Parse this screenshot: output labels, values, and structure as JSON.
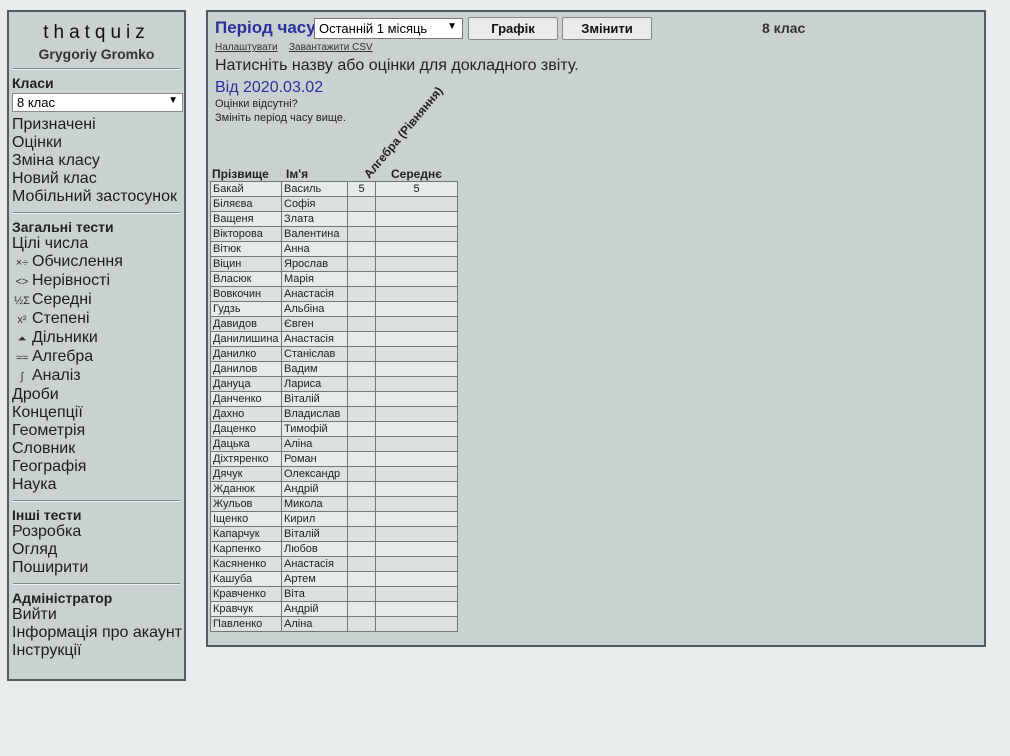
{
  "sidebar": {
    "logo": "thatquiz",
    "user": "Grygoriy Gromko",
    "classes_title": "Класи",
    "class_select": "8 клас",
    "class_items": [
      "Призначені",
      "Оцінки",
      "Зміна класу",
      "Новий клас",
      "Мобільний застосунок"
    ],
    "general_title": "Загальні тести",
    "general_items": [
      {
        "label": "Цілі числа",
        "icon": ""
      },
      {
        "label": "Обчислення",
        "icon": "calc-icon"
      },
      {
        "label": "Нерівності",
        "icon": "inequality-icon"
      },
      {
        "label": "Середні",
        "icon": "sigma-icon"
      },
      {
        "label": "Степені",
        "icon": "power-icon"
      },
      {
        "label": "Дільники",
        "icon": "tree-icon"
      },
      {
        "label": "Алгебра",
        "icon": "algebra-icon"
      },
      {
        "label": "Аналіз",
        "icon": "integral-icon"
      },
      {
        "label": "Дроби",
        "icon": ""
      },
      {
        "label": "Концепції",
        "icon": ""
      },
      {
        "label": "Геометрія",
        "icon": ""
      },
      {
        "label": "Словник",
        "icon": ""
      },
      {
        "label": "Географія",
        "icon": ""
      },
      {
        "label": "Наука",
        "icon": ""
      }
    ],
    "other_title": "Інші тести",
    "other_items": [
      "Розробка",
      "Огляд",
      "Поширити"
    ],
    "admin_title": "Адміністратор",
    "admin_items": [
      "Вийти",
      "Інформація про акаунт",
      "Інструкції"
    ]
  },
  "main": {
    "period_title": "Період часу",
    "period_select": "Останній 1 місяць",
    "graph_button": "Графік",
    "change_button": "Змінити",
    "class_name": "8 клас",
    "settings_link": "Налаштувати",
    "csv_link": "Завантажити CSV",
    "instruction": "Натисніть назву або оцінки для докладного звіту.",
    "from_date": "Від 2020.03.02",
    "no_grades": "Оцінки відсутні?",
    "change_period": "Змініть період часу вище.",
    "header_surname": "Прізвище",
    "header_name": "Ім'я",
    "header_test": "Алгебра (Рівняння)",
    "header_avg": "Середнє"
  },
  "students": [
    {
      "surname": "Бакай",
      "name": "Василь",
      "score": "5",
      "avg": "5"
    },
    {
      "surname": "Біляєва",
      "name": "Софія",
      "score": "",
      "avg": ""
    },
    {
      "surname": "Ващеня",
      "name": "Злата",
      "score": "",
      "avg": ""
    },
    {
      "surname": "Вікторова",
      "name": "Валентина",
      "score": "",
      "avg": ""
    },
    {
      "surname": "Вітюк",
      "name": "Анна",
      "score": "",
      "avg": ""
    },
    {
      "surname": "Віцин",
      "name": "Ярослав",
      "score": "",
      "avg": ""
    },
    {
      "surname": "Власюк",
      "name": "Марія",
      "score": "",
      "avg": ""
    },
    {
      "surname": "Вовкочин",
      "name": "Анастасія",
      "score": "",
      "avg": ""
    },
    {
      "surname": "Гудзь",
      "name": "Альбіна",
      "score": "",
      "avg": ""
    },
    {
      "surname": "Давидов",
      "name": "Євген",
      "score": "",
      "avg": ""
    },
    {
      "surname": "Данилишина",
      "name": "Анастасія",
      "score": "",
      "avg": ""
    },
    {
      "surname": "Данилко",
      "name": "Станіслав",
      "score": "",
      "avg": ""
    },
    {
      "surname": "Данилов",
      "name": "Вадим",
      "score": "",
      "avg": ""
    },
    {
      "surname": "Дануца",
      "name": "Лариса",
      "score": "",
      "avg": ""
    },
    {
      "surname": "Данченко",
      "name": "Віталій",
      "score": "",
      "avg": ""
    },
    {
      "surname": "Дахно",
      "name": "Владислав",
      "score": "",
      "avg": ""
    },
    {
      "surname": "Даценко",
      "name": "Тимофій",
      "score": "",
      "avg": ""
    },
    {
      "surname": "Дацька",
      "name": "Аліна",
      "score": "",
      "avg": ""
    },
    {
      "surname": "Діхтяренко",
      "name": "Роман",
      "score": "",
      "avg": ""
    },
    {
      "surname": "Дячук",
      "name": "Олександр",
      "score": "",
      "avg": ""
    },
    {
      "surname": "Жданюк",
      "name": "Андрій",
      "score": "",
      "avg": ""
    },
    {
      "surname": "Жульов",
      "name": "Микола",
      "score": "",
      "avg": ""
    },
    {
      "surname": "Іщенко",
      "name": "Кирил",
      "score": "",
      "avg": ""
    },
    {
      "surname": "Капарчук",
      "name": "Віталій",
      "score": "",
      "avg": ""
    },
    {
      "surname": "Карпенко",
      "name": "Любов",
      "score": "",
      "avg": ""
    },
    {
      "surname": "Касяненко",
      "name": "Анастасія",
      "score": "",
      "avg": ""
    },
    {
      "surname": "Кашуба",
      "name": "Артем",
      "score": "",
      "avg": ""
    },
    {
      "surname": "Кравченко",
      "name": "Віта",
      "score": "",
      "avg": ""
    },
    {
      "surname": "Кравчук",
      "name": "Андрій",
      "score": "",
      "avg": ""
    },
    {
      "surname": "Павленко",
      "name": "Аліна",
      "score": "",
      "avg": ""
    }
  ],
  "colors": {
    "accent": "#2a2f9c",
    "panel": "#c9d2d1",
    "border": "#4f5d5c"
  }
}
